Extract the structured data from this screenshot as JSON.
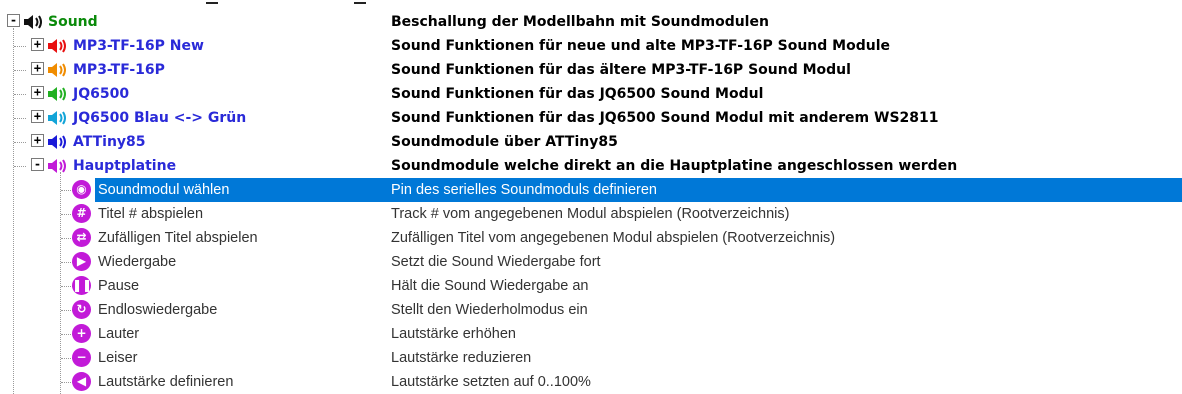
{
  "tree": {
    "root": {
      "label": "Sound",
      "desc": "Beschallung der Modellbahn mit Soundmodulen",
      "expander": "-",
      "color": "#0a8a0a",
      "icon": "speaker-icon"
    },
    "groups": [
      {
        "label": "MP3-TF-16P New",
        "desc": "Sound Funktionen für neue und alte MP3-TF-16P Sound Module",
        "expander": "+",
        "color": "#e81010",
        "icon": "speaker-icon"
      },
      {
        "label": "MP3-TF-16P",
        "desc": "Sound Funktionen für das ältere MP3-TF-16P Sound Modul",
        "expander": "+",
        "color": "#f08c00",
        "icon": "speaker-icon"
      },
      {
        "label": "JQ6500",
        "desc": "Sound Funktionen für das JQ6500 Sound Modul",
        "expander": "+",
        "color": "#22b022",
        "icon": "speaker-icon"
      },
      {
        "label": "JQ6500 Blau <-> Grün",
        "desc": "Sound Funktionen für das JQ6500 Sound Modul mit anderem WS2811",
        "expander": "+",
        "color": "#12a4d8",
        "icon": "speaker-icon"
      },
      {
        "label": "ATTiny85",
        "desc": "Soundmodule über ATTiny85",
        "expander": "+",
        "color": "#1a1ad8",
        "icon": "speaker-icon"
      },
      {
        "label": "Hauptplatine",
        "desc": "Soundmodule welche direkt an die Hauptplatine angeschlossen werden",
        "expander": "-",
        "color": "#c21ad8",
        "icon": "speaker-icon"
      }
    ],
    "label_color": "#2a2ad8",
    "children": [
      {
        "label": "Soundmodul wählen",
        "desc": "Pin des serielles Soundmoduls definieren",
        "icon": "eye-icon",
        "glyph": "◉",
        "selected": true
      },
      {
        "label": "Titel # abspielen",
        "desc": "Track # vom angegebenen Modul abspielen (Rootverzeichnis)",
        "icon": "hash-icon",
        "glyph": "#"
      },
      {
        "label": "Zufälligen Titel abspielen",
        "desc": "Zufälligen Titel vom angegebenen Modul abspielen (Rootverzeichnis)",
        "icon": "shuffle-icon",
        "glyph": "⇄"
      },
      {
        "label": "Wiedergabe",
        "desc": "Setzt die Sound Wiedergabe fort",
        "icon": "play-icon",
        "glyph": "▶"
      },
      {
        "label": "Pause",
        "desc": "Hält die Sound Wiedergabe an",
        "icon": "pause-icon",
        "glyph": "❚❚"
      },
      {
        "label": "Endloswiedergabe",
        "desc": "Stellt den Wiederholmodus ein",
        "icon": "repeat-icon",
        "glyph": "↻"
      },
      {
        "label": "Lauter",
        "desc": "Lautstärke erhöhen",
        "icon": "plus-icon",
        "glyph": "+"
      },
      {
        "label": "Leiser",
        "desc": "Lautstärke reduzieren",
        "icon": "minus-icon",
        "glyph": "−"
      },
      {
        "label": "Lautstärke definieren",
        "desc": "Lautstärke setzten auf 0..100%",
        "icon": "volume-icon",
        "glyph": "◀"
      }
    ],
    "child_icon_color": "#c21ad8",
    "selection_color": "#0078d7"
  }
}
